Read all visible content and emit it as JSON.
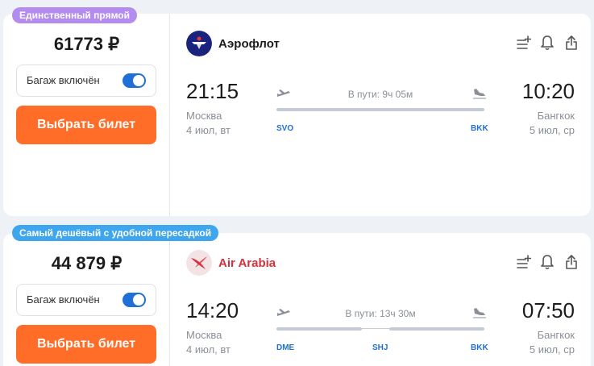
{
  "tickets": [
    {
      "badge": "Единственный прямой",
      "badge_color": "#b48cf0",
      "price": "61773 ₽",
      "baggage_label": "Багаж включён",
      "baggage_on": true,
      "select_label": "Выбрать билет",
      "airline": "Аэрофлот",
      "airline_color": "#1a237e",
      "dep_time": "21:15",
      "arr_time": "10:20",
      "dep_city": "Москва",
      "arr_city": "Бангкок",
      "dep_date": "4 июл, вт",
      "arr_date": "5 июл, ср",
      "duration": "В пути: 9ч 05м",
      "dep_code": "SVO",
      "arr_code": "BKK"
    },
    {
      "badge": "Самый дешёвый с удобной пересадкой",
      "badge_color": "#3ea6ee",
      "price": "44 879 ₽",
      "baggage_label": "Багаж включён",
      "baggage_on": true,
      "select_label": "Выбрать билет",
      "airline": "Air Arabia",
      "airline_color": "#d7323c",
      "dep_time": "14:20",
      "arr_time": "07:50",
      "dep_city": "Москва",
      "arr_city": "Бангкок",
      "dep_date": "4 июл, вт",
      "arr_date": "5 июл, ср",
      "duration": "В пути: 13ч 30м",
      "dep_code": "DME",
      "stop_code": "SHJ",
      "arr_code": "BKK"
    }
  ],
  "icons": [
    "list-add-icon",
    "bell-icon",
    "share-icon",
    "takeoff-icon",
    "landing-icon"
  ],
  "accent_orange": "#ff6d29",
  "accent_blue": "#1f6fd9"
}
